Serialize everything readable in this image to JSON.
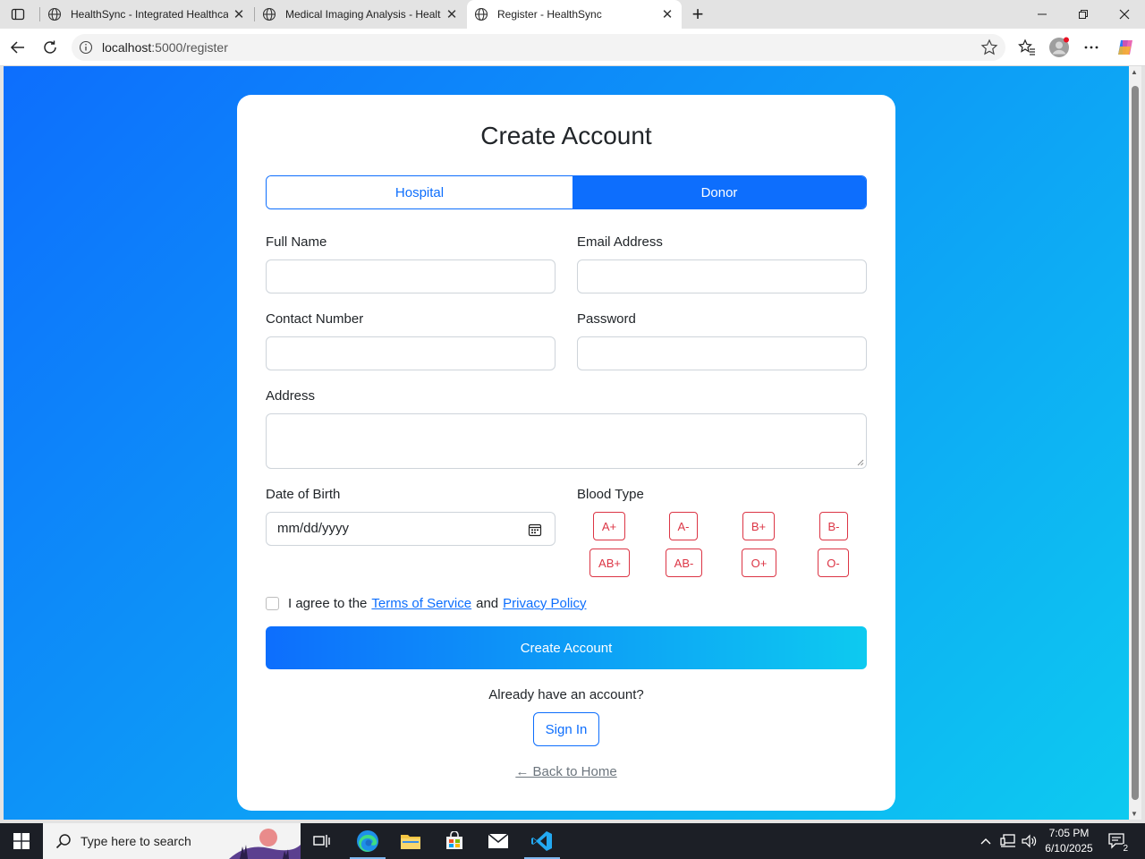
{
  "browser": {
    "tabs": [
      {
        "title": "HealthSync - Integrated Healthca",
        "active": false
      },
      {
        "title": "Medical Imaging Analysis - Healt",
        "active": false
      },
      {
        "title": "Register - HealthSync",
        "active": true
      }
    ],
    "new_tab_symbol": "+",
    "url_host": "localhost",
    "url_rest": ":5000/register"
  },
  "page": {
    "title": "Create Account",
    "account_types": {
      "hospital": "Hospital",
      "donor": "Donor",
      "selected": "Donor"
    },
    "fields": {
      "full_name": {
        "label": "Full Name",
        "value": ""
      },
      "email": {
        "label": "Email Address",
        "value": ""
      },
      "contact": {
        "label": "Contact Number",
        "value": ""
      },
      "password": {
        "label": "Password",
        "value": ""
      },
      "address": {
        "label": "Address",
        "value": ""
      },
      "dob": {
        "label": "Date of Birth",
        "placeholder": "mm/dd/yyyy"
      }
    },
    "blood_type": {
      "label": "Blood Type",
      "options": [
        "A+",
        "A-",
        "B+",
        "B-",
        "AB+",
        "AB-",
        "O+",
        "O-"
      ]
    },
    "agreement": {
      "prefix": "I agree to the",
      "terms": "Terms of Service",
      "and": "and",
      "privacy": "Privacy Policy",
      "checked": false
    },
    "submit_label": "Create Account",
    "already_text": "Already have an account?",
    "signin_label": "Sign In",
    "back_label": "← Back to Home",
    "colors": {
      "primary": "#0d6efd",
      "accent": "#0dcaf0",
      "danger": "#dc3545"
    }
  },
  "taskbar": {
    "search_placeholder": "Type here to search",
    "time": "7:05 PM",
    "date": "6/10/2025",
    "notification_count": "2"
  }
}
